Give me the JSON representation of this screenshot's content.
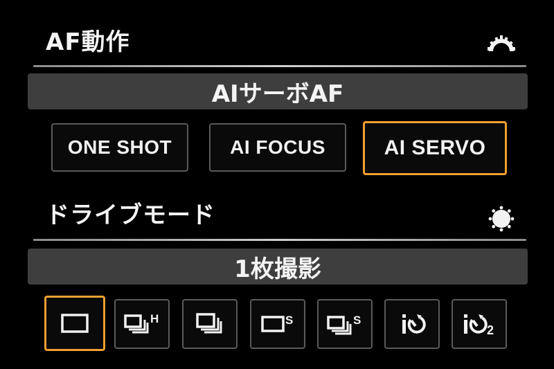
{
  "af_operation": {
    "title": "AF動作",
    "dial_icon": "main-dial-icon",
    "current_value": "AIサーボAF",
    "options": [
      {
        "label": "ONE SHOT",
        "selected": false
      },
      {
        "label": "AI FOCUS",
        "selected": false
      },
      {
        "label": "AI SERVO",
        "selected": true
      }
    ]
  },
  "drive_mode": {
    "title": "ドライブモード",
    "dial_icon": "quick-control-dial-icon",
    "current_value": "1枚撮影",
    "options": [
      {
        "icon": "single-shooting-icon",
        "selected": true
      },
      {
        "icon": "high-speed-continuous-icon",
        "suffix": "H",
        "selected": false
      },
      {
        "icon": "low-speed-continuous-icon",
        "selected": false
      },
      {
        "icon": "silent-single-shooting-icon",
        "suffix": "S",
        "selected": false
      },
      {
        "icon": "silent-continuous-shooting-icon",
        "suffix": "S",
        "selected": false
      },
      {
        "icon": "self-timer-10sec-icon",
        "selected": false
      },
      {
        "icon": "self-timer-2sec-icon",
        "suffix": "2",
        "selected": false
      }
    ]
  },
  "colors": {
    "background": "#000000",
    "selection_accent": "#f0a030",
    "value_bar": "#3e3e3e",
    "button_border": "#5a5a5a"
  }
}
